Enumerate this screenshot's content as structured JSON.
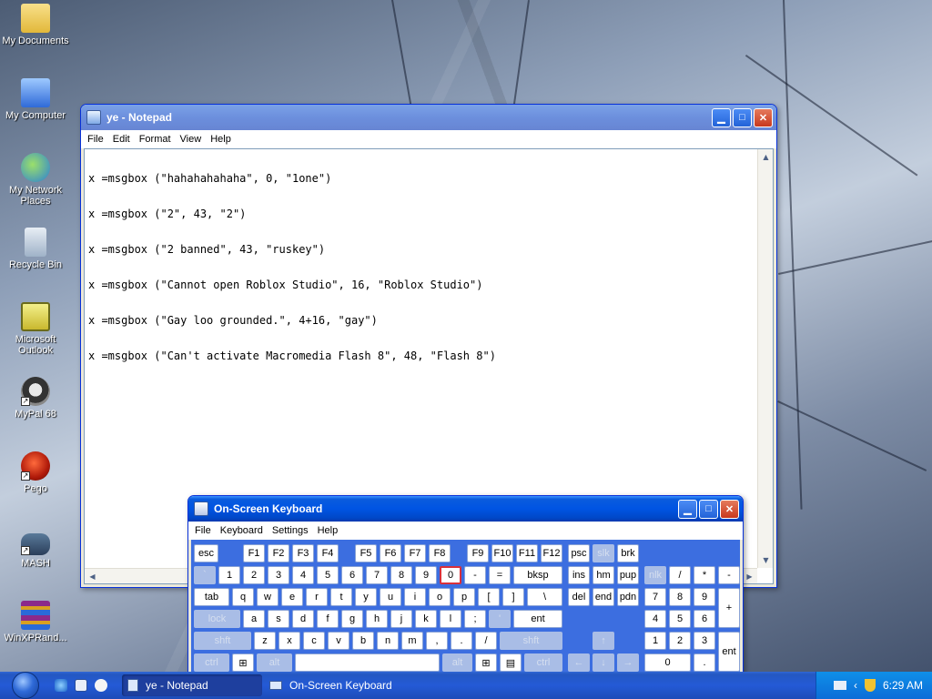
{
  "desktop": {
    "icons": [
      {
        "label": "My Documents"
      },
      {
        "label": "My Computer"
      },
      {
        "label": "My Network Places"
      },
      {
        "label": "Recycle Bin"
      },
      {
        "label": "Microsoft Outlook"
      },
      {
        "label": "MyPal 68"
      },
      {
        "label": "Pego"
      },
      {
        "label": "MASH"
      },
      {
        "label": "WinXPRand..."
      }
    ]
  },
  "notepad": {
    "title": "ye - Notepad",
    "menu": [
      "File",
      "Edit",
      "Format",
      "View",
      "Help"
    ],
    "lines": [
      "x =msgbox (\"hahahahahaha\", 0, \"1one\")",
      "x =msgbox (\"2\", 43, \"2\")",
      "x =msgbox (\"2 banned\", 43, \"ruskey\")",
      "x =msgbox (\"Cannot open Roblox Studio\", 16, \"Roblox Studio\")",
      "x =msgbox (\"Gay loo grounded.\", 4+16, \"gay\")",
      "x =msgbox (\"Can't activate Macromedia Flash 8\", 48, \"Flash 8\")"
    ]
  },
  "osk": {
    "title": "On-Screen Keyboard",
    "menu": [
      "File",
      "Keyboard",
      "Settings",
      "Help"
    ],
    "rows": {
      "fn": [
        "esc",
        "F1",
        "F2",
        "F3",
        "F4",
        "F5",
        "F6",
        "F7",
        "F8",
        "F9",
        "F10",
        "F11",
        "F12",
        "psc",
        "slk",
        "brk"
      ],
      "num": [
        "`",
        "1",
        "2",
        "3",
        "4",
        "5",
        "6",
        "7",
        "8",
        "9",
        "0",
        "-",
        "=",
        "bksp",
        "ins",
        "hm",
        "pup",
        "nlk",
        "/",
        "*",
        "-"
      ],
      "tab": [
        "tab",
        "q",
        "w",
        "e",
        "r",
        "t",
        "y",
        "u",
        "i",
        "o",
        "p",
        "[",
        "]",
        "\\",
        "del",
        "end",
        "pdn",
        "7",
        "8",
        "9",
        "+"
      ],
      "caps": [
        "lock",
        "a",
        "s",
        "d",
        "f",
        "g",
        "h",
        "j",
        "k",
        "l",
        ";",
        "'",
        "ent",
        "4",
        "5",
        "6"
      ],
      "shift": [
        "shft",
        "z",
        "x",
        "c",
        "v",
        "b",
        "n",
        "m",
        ",",
        ".",
        "/",
        "shft",
        "↑",
        "1",
        "2",
        "3",
        "ent"
      ],
      "ctrl": [
        "ctrl",
        "⊞",
        "alt",
        "alt",
        "⊞",
        "▤",
        "ctrl",
        "←",
        "↓",
        "→",
        "0",
        "."
      ]
    }
  },
  "taskbar": {
    "tasks": [
      "ye - Notepad",
      "On-Screen Keyboard"
    ],
    "clock": "6:29 AM"
  },
  "colors": {
    "titlebar": "#0054e3",
    "osk_panel": "#3c6ee0",
    "highlight_key": "#d9303a"
  }
}
